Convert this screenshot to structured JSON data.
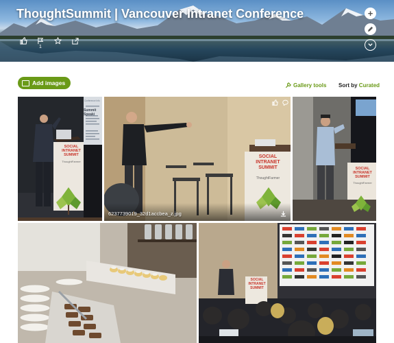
{
  "banner": {
    "title": "ThoughtSummit | Vancouver Intranet Conference",
    "like_count": "1",
    "icons": [
      "like-icon",
      "flag-icon",
      "star-icon",
      "share-icon"
    ],
    "buttons": [
      "add-icon",
      "edit-icon",
      "chevron-down-icon"
    ]
  },
  "toolbar": {
    "add_images_label": "Add images",
    "gallery_tools_label": "Gallery tools",
    "sort_label": "Sort by",
    "sort_value": "Curated"
  },
  "photos": {
    "p1": {
      "sign_line1": "SOCIAL",
      "sign_line2": "INTRANET",
      "sign_line3": "SUMMIT",
      "sign_brand": "ThoughtFarmer",
      "screen_heading": "Summit Speaki"
    },
    "p2": {
      "caption": "6237739019_32d1accbea_z.jpg",
      "sign_line1": "SOCIAL",
      "sign_line2": "INTRANET",
      "sign_line3": "SUMMIT",
      "sign_brand": "ThoughtFarmer"
    },
    "p3": {
      "sign_line1": "SOCIAL",
      "sign_line2": "INTRANET",
      "sign_line3": "SUMMIT",
      "sign_brand": "ThoughtFarmer"
    },
    "p5": {
      "sign_line1": "SOCIAL",
      "sign_line2": "INTRANET",
      "sign_line3": "SUMMIT"
    }
  },
  "colors": {
    "accent": "#6a9a17",
    "sign_red": "#c8352b",
    "sign_green": "#7fb33a"
  }
}
